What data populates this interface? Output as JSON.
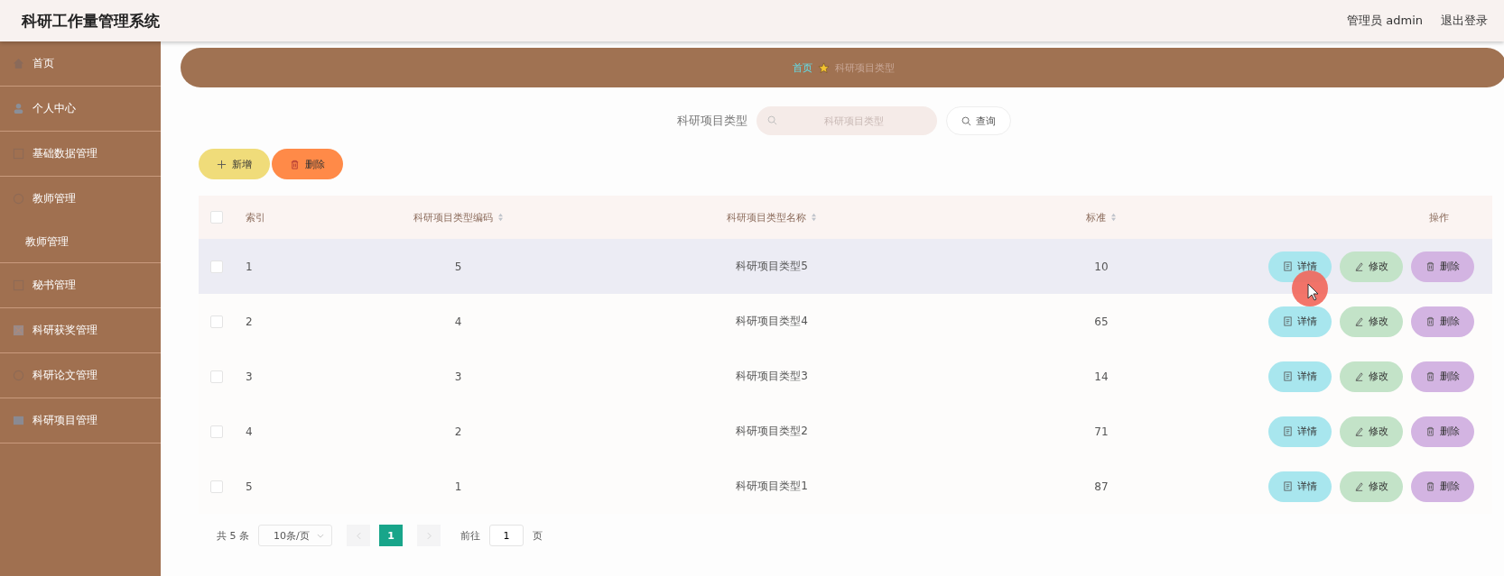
{
  "header": {
    "title": "科研工作量管理系统",
    "user": "管理员 admin",
    "logout": "退出登录"
  },
  "sidebar": {
    "items": [
      {
        "label": "首页"
      },
      {
        "label": "个人中心"
      },
      {
        "label": "基础数据管理"
      },
      {
        "label": "教师管理",
        "expanded": true,
        "children": [
          {
            "label": "教师管理"
          }
        ]
      },
      {
        "label": "秘书管理"
      },
      {
        "label": "科研获奖管理"
      },
      {
        "label": "科研论文管理"
      },
      {
        "label": "科研项目管理"
      }
    ]
  },
  "breadcrumb": [
    {
      "label": "首页",
      "kind": "link"
    },
    {
      "label": "科研项目类型",
      "kind": "current"
    }
  ],
  "search": {
    "label": "科研项目类型",
    "placeholder": "科研项目类型",
    "button": "查询"
  },
  "toolbar": [
    {
      "label": "新增",
      "kind": "add"
    },
    {
      "label": "删除",
      "kind": "delete"
    }
  ],
  "table": {
    "select_all_checked": false,
    "columns": [
      {
        "label": "索引",
        "sortable": false
      },
      {
        "label": "科研项目类型编码",
        "sortable": true
      },
      {
        "label": "科研项目类型名称",
        "sortable": true
      },
      {
        "label": "标准",
        "sortable": true
      },
      {
        "label": "操作",
        "sortable": false
      }
    ],
    "rows": [
      {
        "index": "1",
        "code": "5",
        "name": "科研项目类型5",
        "standard": "10",
        "highlighted": true,
        "checked": false,
        "actions": [
          {
            "label": "详情",
            "kind": "detail"
          },
          {
            "label": "修改",
            "kind": "edit"
          },
          {
            "label": "删除",
            "kind": "delete"
          }
        ]
      },
      {
        "index": "2",
        "code": "4",
        "name": "科研项目类型4",
        "standard": "65",
        "highlighted": false,
        "checked": false,
        "actions": [
          {
            "label": "详情",
            "kind": "detail"
          },
          {
            "label": "修改",
            "kind": "edit"
          },
          {
            "label": "删除",
            "kind": "delete"
          }
        ]
      },
      {
        "index": "3",
        "code": "3",
        "name": "科研项目类型3",
        "standard": "14",
        "highlighted": false,
        "checked": false,
        "actions": [
          {
            "label": "详情",
            "kind": "detail"
          },
          {
            "label": "修改",
            "kind": "edit"
          },
          {
            "label": "删除",
            "kind": "delete"
          }
        ]
      },
      {
        "index": "4",
        "code": "2",
        "name": "科研项目类型2",
        "standard": "71",
        "highlighted": false,
        "checked": false,
        "actions": [
          {
            "label": "详情",
            "kind": "detail"
          },
          {
            "label": "修改",
            "kind": "edit"
          },
          {
            "label": "删除",
            "kind": "delete"
          }
        ]
      },
      {
        "index": "5",
        "code": "1",
        "name": "科研项目类型1",
        "standard": "87",
        "highlighted": false,
        "checked": false,
        "actions": [
          {
            "label": "详情",
            "kind": "detail"
          },
          {
            "label": "修改",
            "kind": "edit"
          },
          {
            "label": "删除",
            "kind": "delete"
          }
        ]
      }
    ]
  },
  "pagination": {
    "total": "共 5 条",
    "page_size": "10条/页",
    "pages": [
      {
        "label": "1",
        "selected": true
      }
    ],
    "goto_label": "前往",
    "goto_value": "1",
    "goto_suffix": "页"
  }
}
